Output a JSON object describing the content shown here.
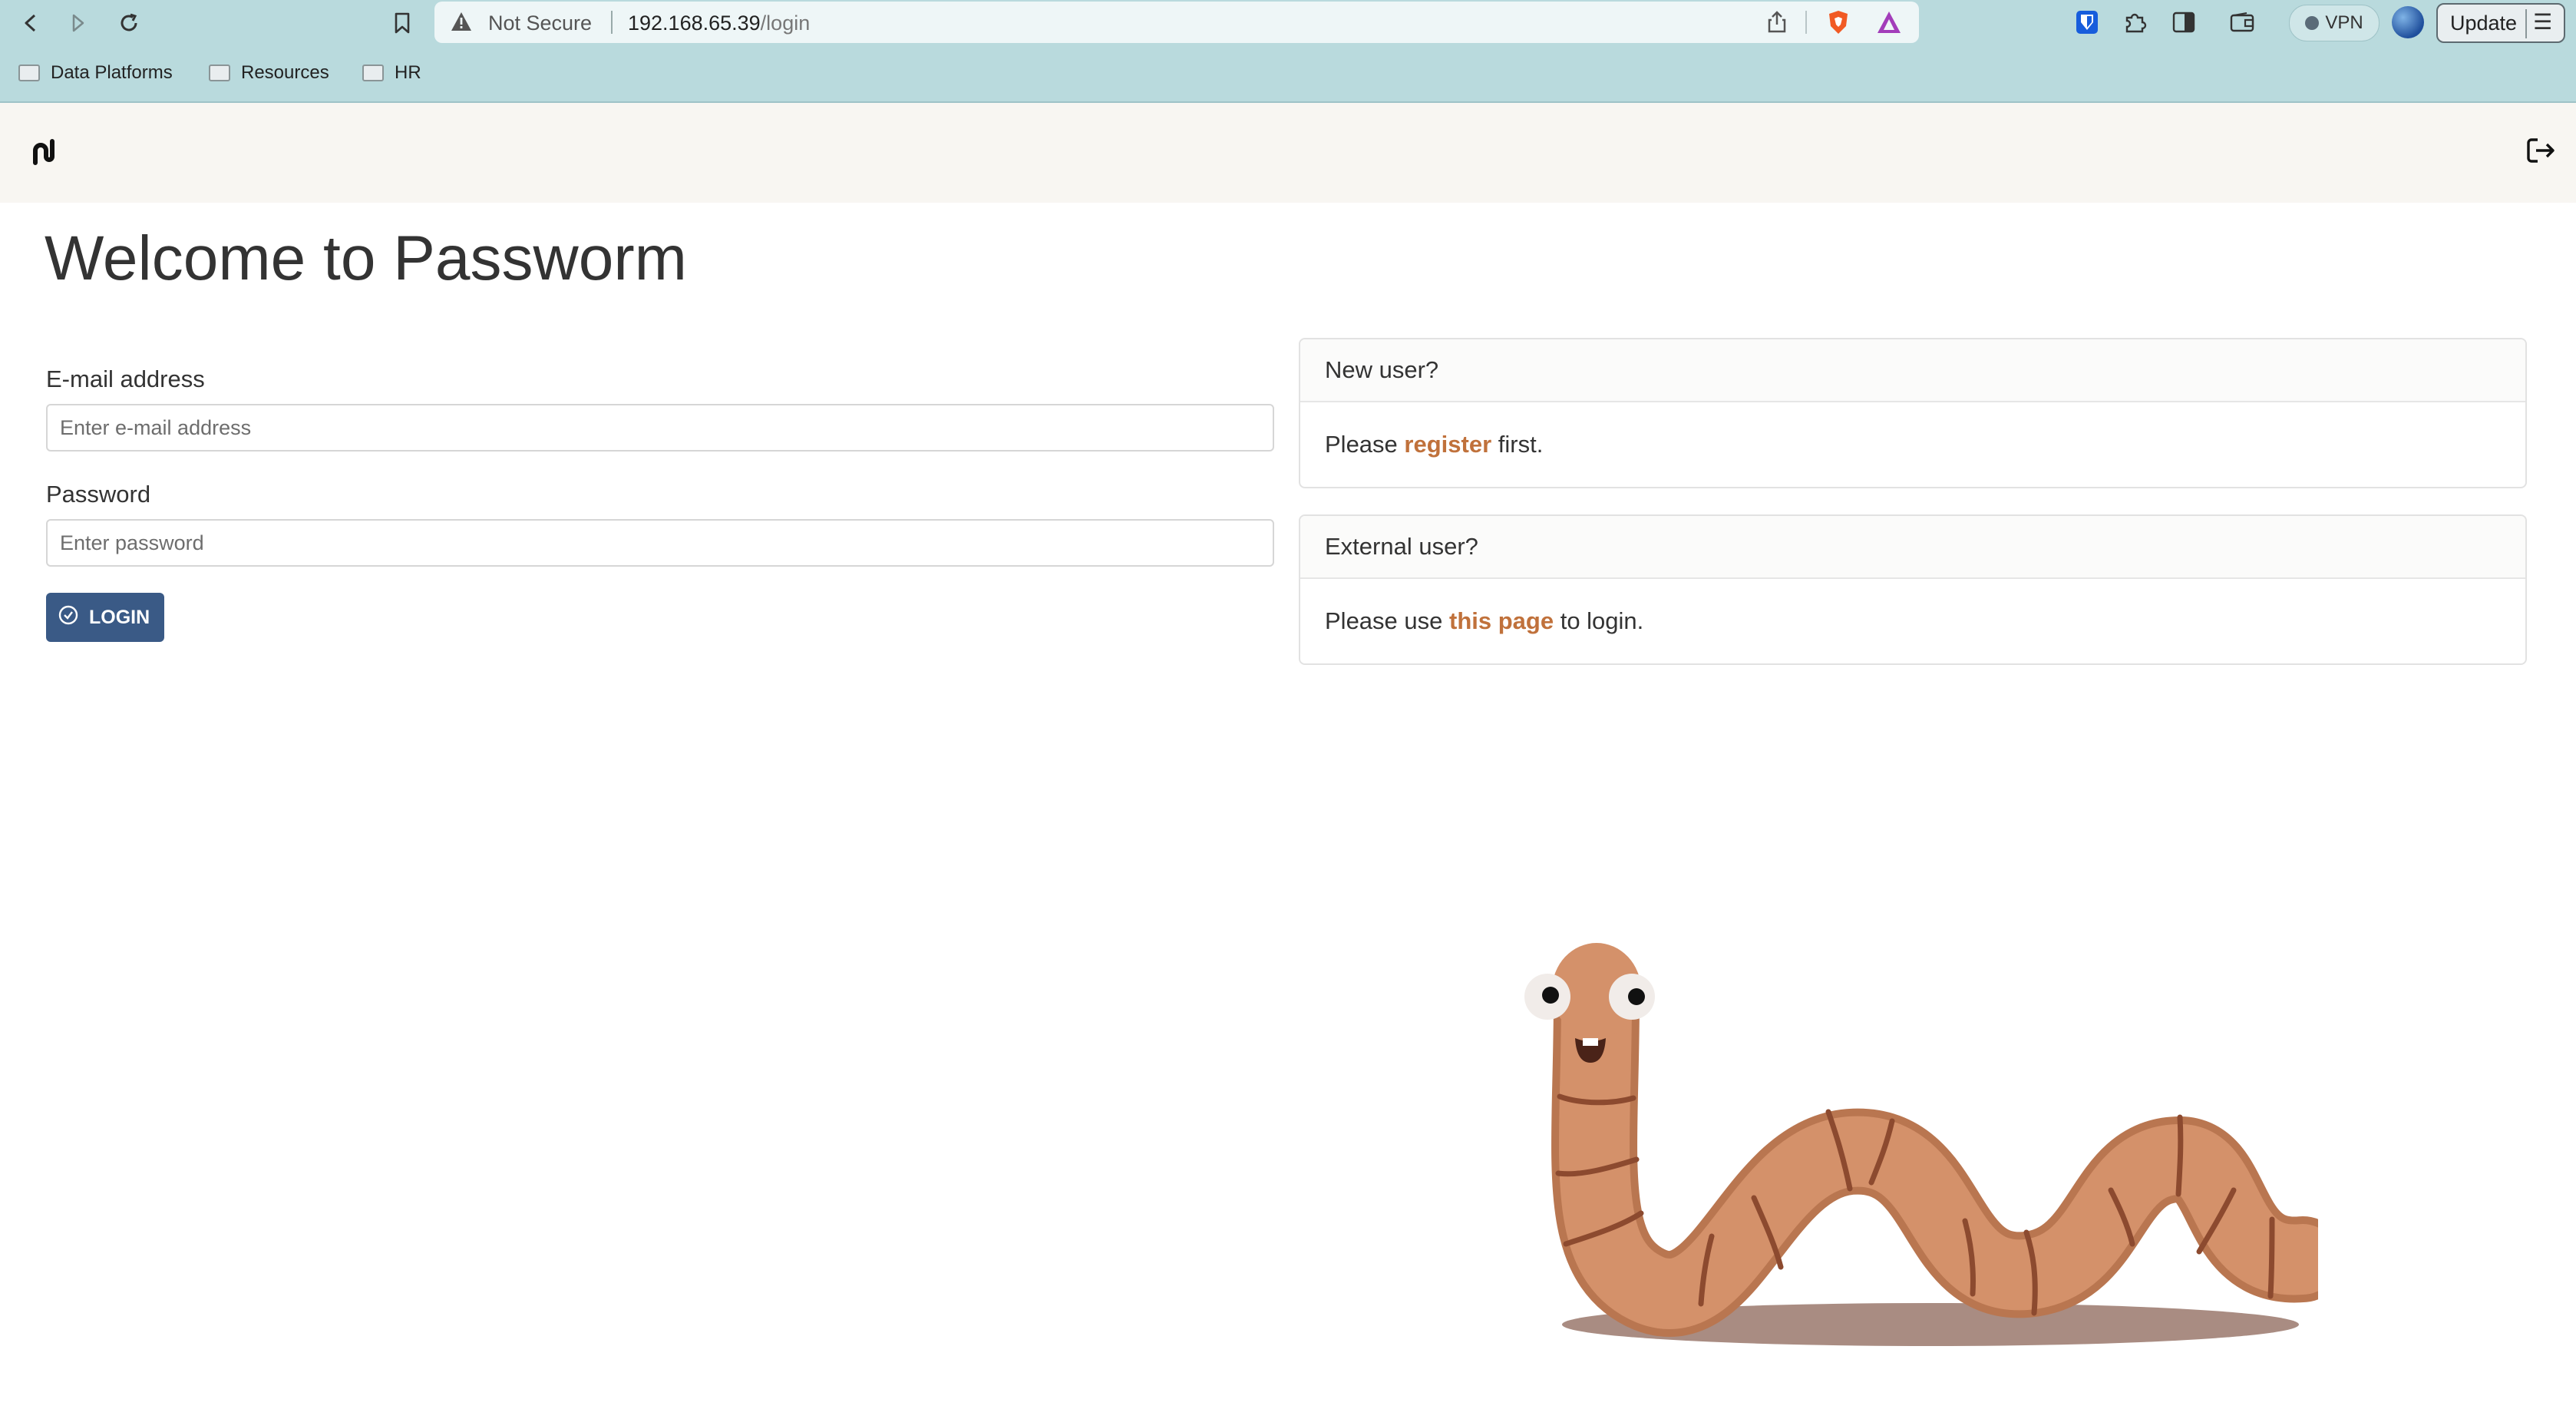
{
  "browser": {
    "security_label": "Not Secure",
    "url_host": "192.168.65.39",
    "url_path": "/login",
    "vpn_label": "VPN",
    "update_label": "Update",
    "bookmarks": [
      {
        "label": "Data Platforms"
      },
      {
        "label": "Resources"
      },
      {
        "label": "HR"
      }
    ]
  },
  "page": {
    "title": "Welcome to Passworm",
    "email": {
      "label": "E-mail address",
      "placeholder": "Enter e-mail address",
      "value": ""
    },
    "password": {
      "label": "Password",
      "placeholder": "Enter password",
      "value": ""
    },
    "login_button": "LOGIN",
    "new_user": {
      "heading": "New user?",
      "prefix": "Please ",
      "link": "register",
      "suffix": " first."
    },
    "external_user": {
      "heading": "External user?",
      "prefix": "Please use ",
      "link": "this page",
      "suffix": " to login."
    }
  },
  "colors": {
    "chrome_bg": "#b9dadd",
    "header_bg": "#f8f6f2",
    "button_bg": "#3a5a86",
    "link": "#c0713b",
    "worm": "#d4916a"
  },
  "icons": {
    "back": "back-arrow-icon",
    "forward": "forward-arrow-icon",
    "reload": "reload-icon",
    "bookmark": "bookmark-icon",
    "warning": "warning-icon",
    "share": "share-icon",
    "brave": "brave-shield-icon",
    "rewards": "brave-rewards-icon",
    "bitwarden": "bitwarden-icon",
    "extensions": "extensions-icon",
    "sidebar": "sidebar-icon",
    "wallet": "wallet-icon",
    "logout": "logout-icon",
    "login": "check-circle-icon"
  }
}
